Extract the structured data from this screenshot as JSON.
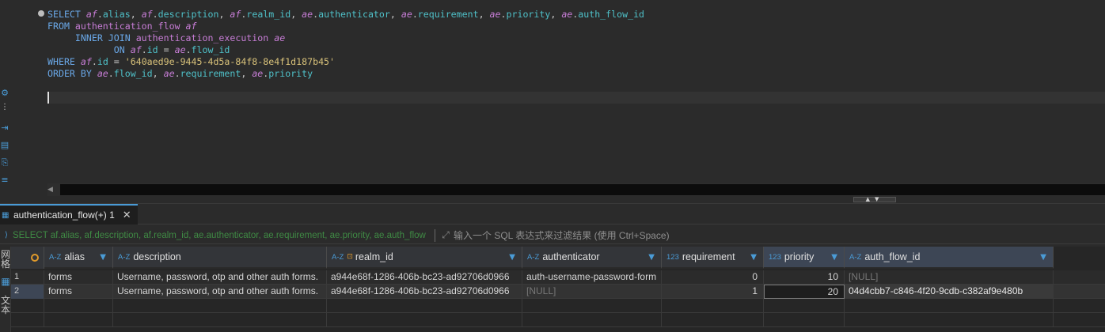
{
  "editor": {
    "sql": {
      "select_kw": "SELECT",
      "from_kw": "FROM",
      "inner_join_kw": "INNER JOIN",
      "on_kw": "ON",
      "where_kw": "WHERE",
      "order_by_kw": "ORDER BY",
      "alias_af": "af",
      "alias_ae": "ae",
      "table_flow": "authentication_flow",
      "table_exec": "authentication_execution",
      "col_alias": "alias",
      "col_description": "description",
      "col_realm_id": "realm_id",
      "col_authenticator": "authenticator",
      "col_requirement": "requirement",
      "col_priority": "priority",
      "col_auth_flow_id": "auth_flow_id",
      "col_id": "id",
      "col_flow_id": "flow_id",
      "id_literal": "'640aed9e-9445-4d5a-84f8-8e4f1d187b45'"
    }
  },
  "results": {
    "tab_label": "authentication_flow(+) 1",
    "filter_sql": "SELECT af.alias, af.description, af.realm_id, ae.authenticator, ae.requirement, ae.priority, ae.auth_flow",
    "filter_placeholder": "输入一个 SQL 表达式来过滤结果 (使用 Ctrl+Space)",
    "side_tabs": [
      "网格",
      "文本"
    ],
    "columns": [
      {
        "type": "A-Z",
        "name": "alias"
      },
      {
        "type": "A-Z",
        "name": "description"
      },
      {
        "type": "A-Z",
        "name": "realm_id"
      },
      {
        "type": "A-Z",
        "name": "authenticator"
      },
      {
        "type": "123",
        "name": "requirement"
      },
      {
        "type": "123",
        "name": "priority"
      },
      {
        "type": "A-Z",
        "name": "auth_flow_id"
      }
    ],
    "rows": [
      {
        "num": "1",
        "alias": "forms",
        "description": "Username, password, otp and other auth forms.",
        "realm_id": "a944e68f-1286-406b-bc23-ad92706d0966",
        "authenticator": "auth-username-password-form",
        "requirement": "0",
        "priority": "10",
        "auth_flow_id": "[NULL]"
      },
      {
        "num": "2",
        "alias": "forms",
        "description": "Username, password, otp and other auth forms.",
        "realm_id": "a944e68f-1286-406b-bc23-ad92706d0966",
        "authenticator": "[NULL]",
        "requirement": "1",
        "priority": "20",
        "auth_flow_id": "04d4cbb7-c846-4f20-9cdb-c382af9e480b"
      }
    ]
  }
}
